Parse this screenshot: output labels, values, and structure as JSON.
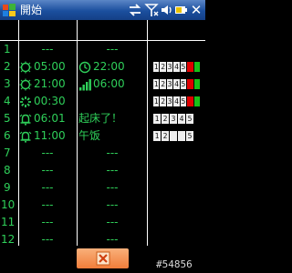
{
  "titlebar": {
    "title": "開始",
    "icons": [
      "windows-flag-icon",
      "sync-arrows-icon",
      "signal-off-icon",
      "volume-icon",
      "battery-icon",
      "close-icon"
    ]
  },
  "table": {
    "rows": [
      {
        "num": "1",
        "c1": {
          "icon": null,
          "text": "---"
        },
        "c2": {
          "icon": null,
          "text": "---"
        },
        "status": "none"
      },
      {
        "num": "2",
        "c1": {
          "icon": "sun-timer-icon",
          "text": "05:00"
        },
        "c2": {
          "icon": "clock-icon",
          "text": "22:00"
        },
        "status": "12345 red-green"
      },
      {
        "num": "3",
        "c1": {
          "icon": "sun-timer-icon",
          "text": "21:00"
        },
        "c2": {
          "icon": "signal-icon",
          "text": "06:00"
        },
        "status": "12345 red-green"
      },
      {
        "num": "4",
        "c1": {
          "icon": "spinner-icon",
          "text": "00:30"
        },
        "c2": {
          "icon": null,
          "text": ""
        },
        "status": "12345 red-green"
      },
      {
        "num": "5",
        "c1": {
          "icon": "alarm-bell-icon",
          "text": "06:01"
        },
        "c2": {
          "icon": null,
          "text": "起床了！"
        },
        "status": "12345"
      },
      {
        "num": "6",
        "c1": {
          "icon": "alarm-bell-icon",
          "text": "11:00"
        },
        "c2": {
          "icon": null,
          "text": "午饭"
        },
        "status": "1 2 _ _ 5"
      },
      {
        "num": "7",
        "c1": {
          "icon": null,
          "text": "---"
        },
        "c2": {
          "icon": null,
          "text": "---"
        },
        "status": "none"
      },
      {
        "num": "8",
        "c1": {
          "icon": null,
          "text": "---"
        },
        "c2": {
          "icon": null,
          "text": "---"
        },
        "status": "none"
      },
      {
        "num": "9",
        "c1": {
          "icon": null,
          "text": "---"
        },
        "c2": {
          "icon": null,
          "text": "---"
        },
        "status": "none"
      },
      {
        "num": "10",
        "c1": {
          "icon": null,
          "text": "---"
        },
        "c2": {
          "icon": null,
          "text": "---"
        },
        "status": "none"
      },
      {
        "num": "11",
        "c1": {
          "icon": null,
          "text": "---"
        },
        "c2": {
          "icon": null,
          "text": "---"
        },
        "status": "none"
      },
      {
        "num": "12",
        "c1": {
          "icon": null,
          "text": "---"
        },
        "c2": {
          "icon": null,
          "text": "---"
        },
        "status": "none"
      }
    ],
    "digits": {
      "r2": [
        "1",
        "2",
        "3",
        "4",
        "5",
        "",
        ""
      ],
      "r3": [
        "1",
        "2",
        "3",
        "4",
        "5",
        "",
        ""
      ],
      "r4": [
        "1",
        "2",
        "3",
        "4",
        "5",
        "",
        ""
      ],
      "r5": [
        "1",
        "2",
        "3",
        "4",
        "5"
      ],
      "r6": [
        "1",
        "2",
        "",
        "",
        "5"
      ]
    }
  },
  "softkey": {
    "icon": "cancel-x-icon"
  },
  "watermark": "#54856",
  "colors": {
    "text": "#2fd05a",
    "titlebar": "#1b4f9e",
    "softkey": "#f07d3a",
    "red": "#e00000",
    "green": "#18c018"
  }
}
